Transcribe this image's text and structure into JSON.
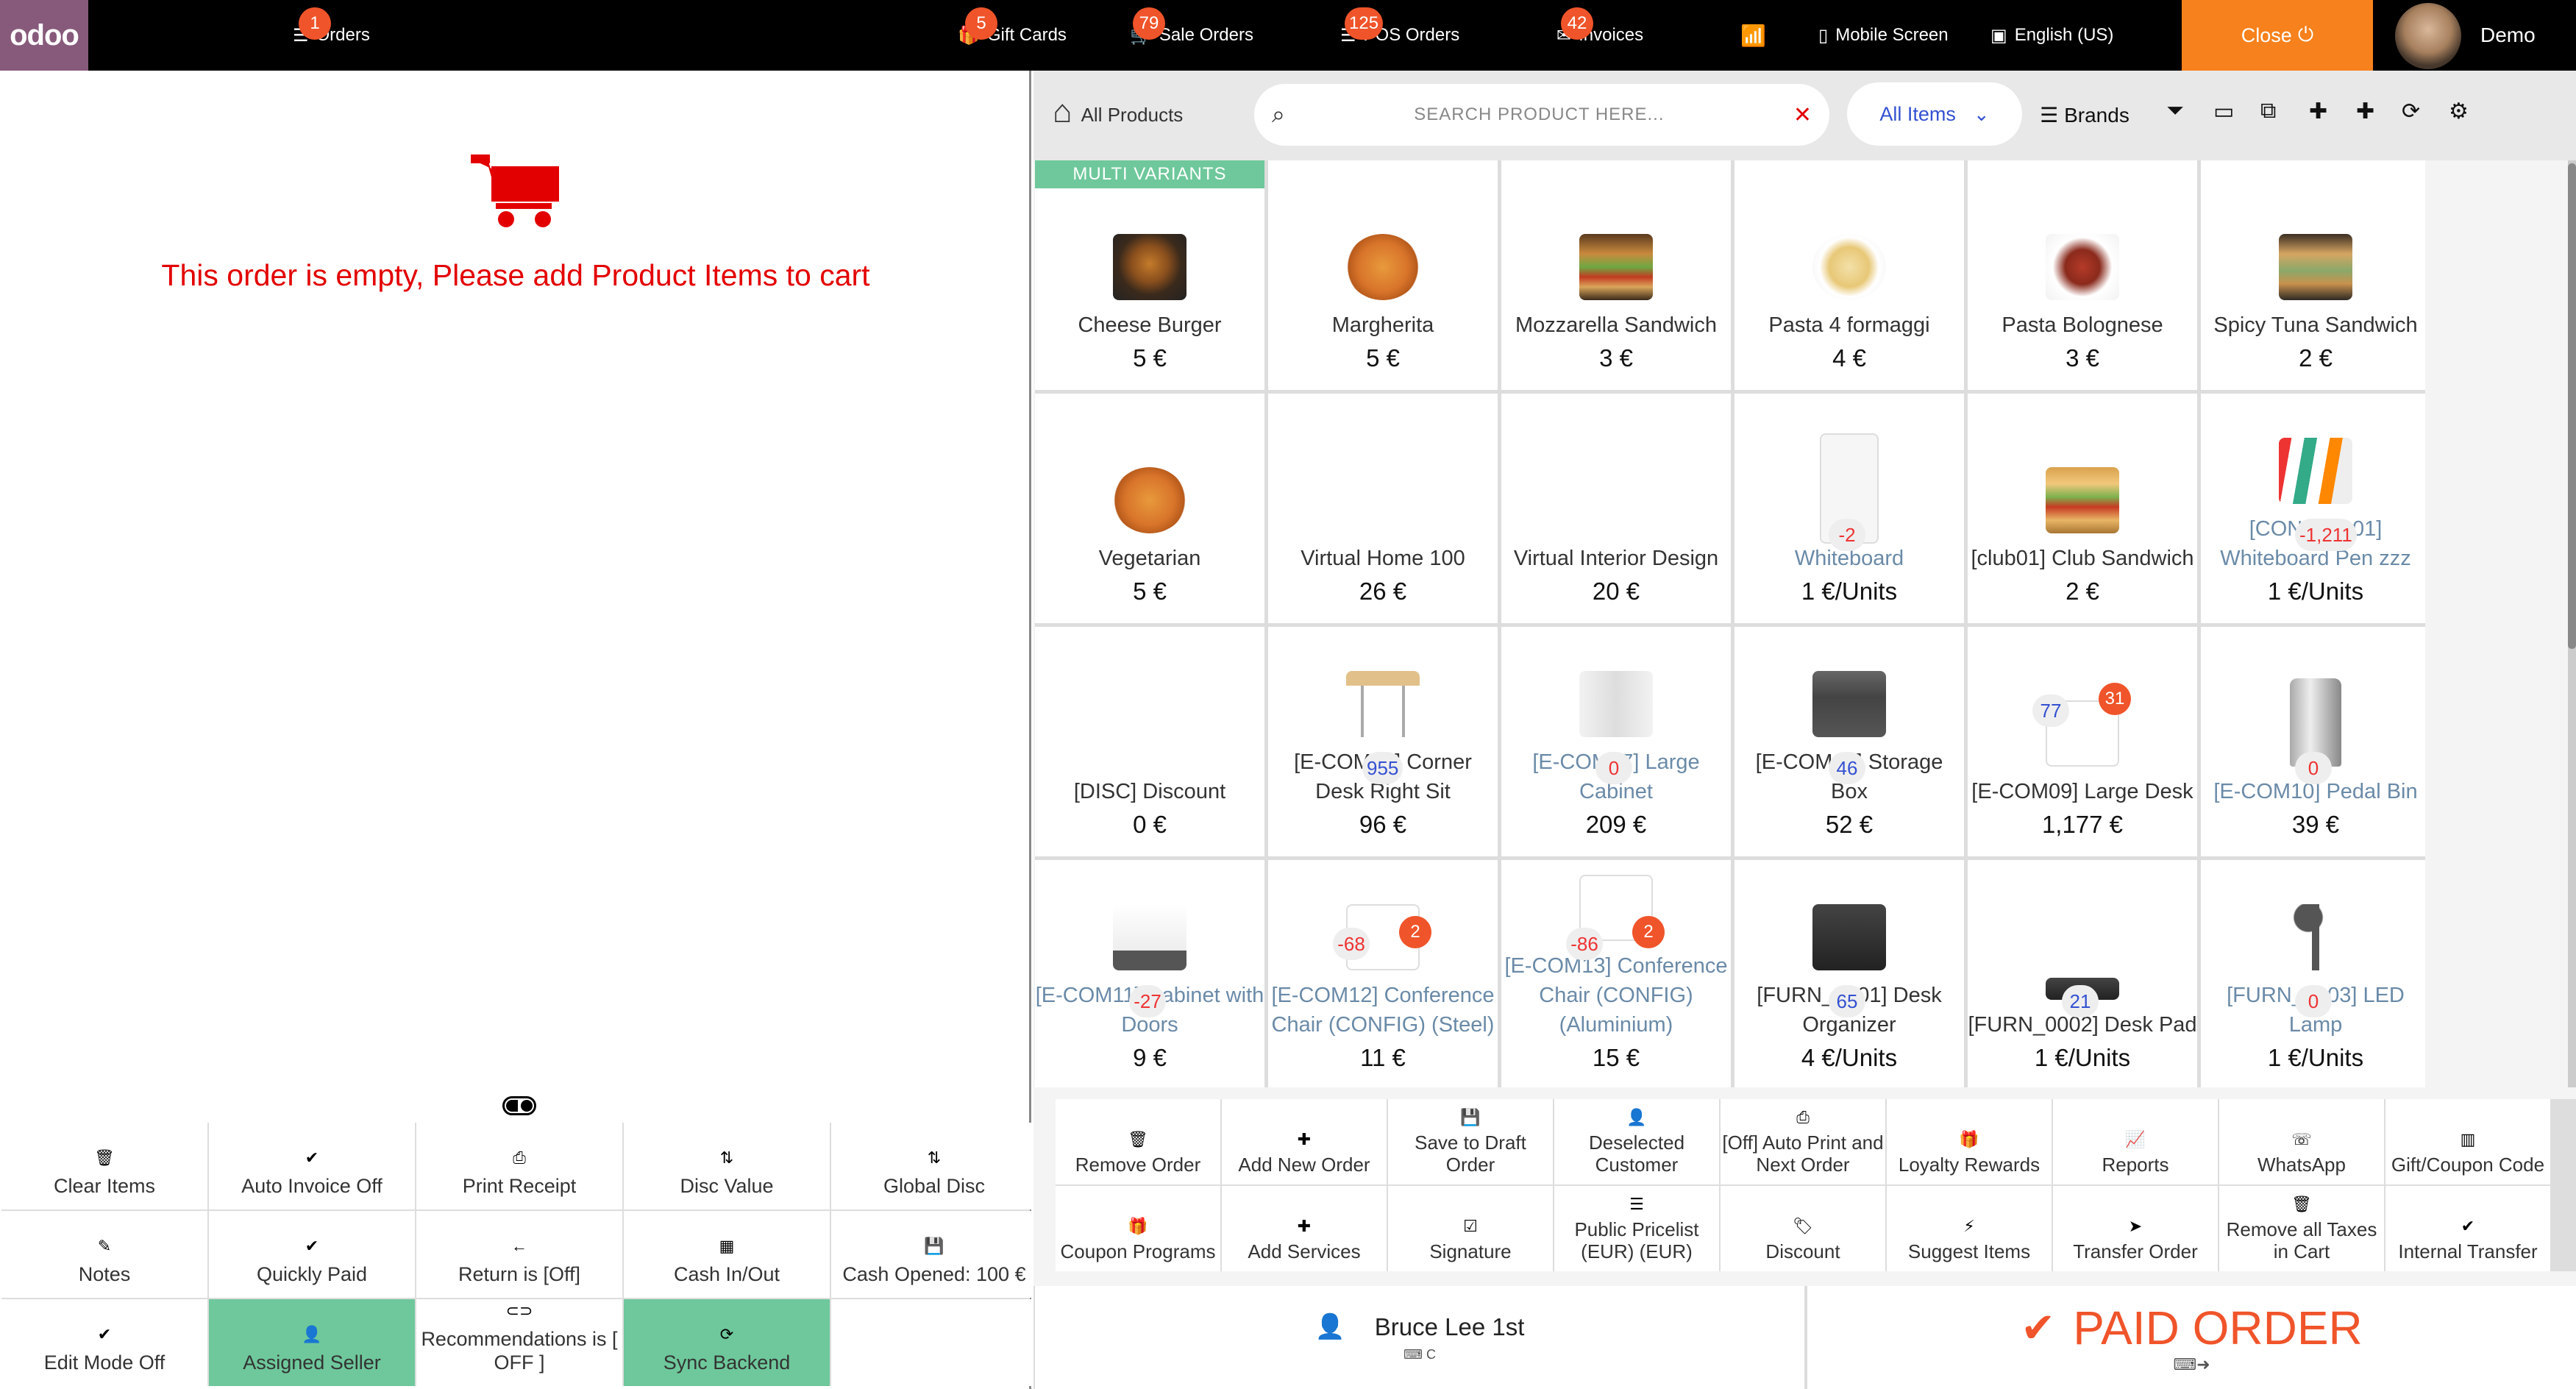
{
  "topbar": {
    "logo": "odoo",
    "orders": {
      "label": "Orders",
      "count": "1"
    },
    "gift_cards": {
      "label": "Gift Cards",
      "count": "5"
    },
    "sale_orders": {
      "label": "Sale Orders",
      "count": "79"
    },
    "pos_orders": {
      "label": "POS Orders",
      "count": "125"
    },
    "invoices": {
      "label": "Invoices",
      "count": "42"
    },
    "mobile_screen": "Mobile Screen",
    "language": "English (US)",
    "close": "Close",
    "user": "Demo"
  },
  "cart": {
    "empty_message": "This order is empty, Please add Product Items to cart"
  },
  "left_buttons": [
    {
      "label": "Clear Items",
      "icon": "trash-icon",
      "glyph": "🗑",
      "style": ""
    },
    {
      "label": "Auto Invoice Off",
      "icon": "check-icon",
      "glyph": "✔",
      "style": ""
    },
    {
      "label": "Print Receipt",
      "icon": "print-icon",
      "glyph": "⎙",
      "style": ""
    },
    {
      "label": "Disc Value",
      "icon": "sort-icon",
      "glyph": "⇅",
      "style": ""
    },
    {
      "label": "Global Disc",
      "icon": "sort-icon",
      "glyph": "⇅",
      "style": ""
    },
    {
      "label": "Notes",
      "icon": "edit-icon",
      "glyph": "✎",
      "style": ""
    },
    {
      "label": "Quickly Paid",
      "icon": "check-icon",
      "glyph": "✔",
      "style": ""
    },
    {
      "label": "Return is [Off]",
      "icon": "arrow-left-icon",
      "glyph": "←",
      "style": ""
    },
    {
      "label": "Cash In/Out",
      "icon": "calculator-icon",
      "glyph": "▦",
      "style": ""
    },
    {
      "label": "Cash Opened: 100 €",
      "icon": "save-icon",
      "glyph": "💾",
      "style": ""
    },
    {
      "label": "Edit Mode Off",
      "icon": "check-icon",
      "glyph": "✔",
      "style": ""
    },
    {
      "label": "Assigned Seller",
      "icon": "user-icon",
      "glyph": "👤",
      "style": "green"
    },
    {
      "label": "Recommendations is [ OFF ]",
      "icon": "toggle-icon",
      "glyph": "⊂⊃",
      "style": ""
    },
    {
      "label": "Sync Backend",
      "icon": "refresh-icon",
      "glyph": "⟳",
      "style": "green"
    },
    {
      "label": "",
      "icon": "",
      "glyph": "",
      "style": "empty"
    }
  ],
  "right_header": {
    "home_label": "All Products",
    "search_placeholder": "SEARCH PRODUCT HERE...",
    "category_filter": "All Items",
    "brands": "Brands"
  },
  "products": [
    {
      "name": "Cheese Burger",
      "price": "5 €",
      "img": "burger",
      "multi": "MULTI VARIANTS"
    },
    {
      "name": "Margherita",
      "price": "5 €",
      "img": "pizza"
    },
    {
      "name": "Mozzarella Sandwich",
      "price": "3 €",
      "img": "sandwich"
    },
    {
      "name": "Pasta 4 formaggi",
      "price": "4 €",
      "img": "pasta"
    },
    {
      "name": "Pasta Bolognese",
      "price": "3 €",
      "img": "bolognese"
    },
    {
      "name": "Spicy Tuna Sandwich",
      "price": "2 €",
      "img": "tuna"
    },
    {
      "name": "Vegetarian",
      "price": "5 €",
      "img": "pizza"
    },
    {
      "name": "Virtual Home 100",
      "price": "26 €",
      "img": ""
    },
    {
      "name": "Virtual Interior Design",
      "price": "20 €",
      "img": ""
    },
    {
      "name": "Whiteboard",
      "price": "1 €/Units",
      "img": "whiteboard",
      "stock": "-2",
      "muted": true
    },
    {
      "name": "[club01] Club Sandwich",
      "price": "2 €",
      "img": "club"
    },
    {
      "name": "[CONS_0001] Whiteboard Pen zzz",
      "price": "1 €/Units",
      "img": "pens",
      "stock": "-1,211",
      "muted": true
    },
    {
      "name": "[DISC] Discount",
      "price": "0 €",
      "img": ""
    },
    {
      "name": "[E-COM06] Corner Desk Right Sit",
      "price": "96 €",
      "img": "desk",
      "stock": "955"
    },
    {
      "name": "[E-COM07] Large Cabinet",
      "price": "209 €",
      "img": "cabinet",
      "stock": "0",
      "muted": true
    },
    {
      "name": "[E-COM08] Storage Box",
      "price": "52 €",
      "img": "box",
      "stock": "46"
    },
    {
      "name": "[E-COM09] Large Desk",
      "price": "1,177 €",
      "img": "group",
      "stock": "77",
      "order_badge": "31"
    },
    {
      "name": "[E-COM10] Pedal Bin",
      "price": "39 €",
      "img": "bin",
      "stock": "0",
      "muted": true
    },
    {
      "name": "[E-COM11] Cabinet with Doors",
      "price": "9 €",
      "img": "cabinet2",
      "stock": "-27",
      "muted": true
    },
    {
      "name": "[E-COM12] Conference Chair (CONFIG) (Steel)",
      "price": "11 €",
      "img": "group",
      "stock": "-68",
      "order_badge": "2",
      "muted": true
    },
    {
      "name": "[E-COM13] Conference Chair (CONFIG) (Aluminium)",
      "price": "15 €",
      "img": "group",
      "stock": "-86",
      "order_badge": "2",
      "muted": true
    },
    {
      "name": "[FURN_0001] Desk Organizer",
      "price": "4 €/Units",
      "img": "organizer",
      "stock": "65"
    },
    {
      "name": "[FURN_0002] Desk Pad",
      "price": "1 €/Units",
      "img": "pad",
      "stock": "21"
    },
    {
      "name": "[FURN_0003] LED Lamp",
      "price": "1 €/Units",
      "img": "lamp",
      "stock": "0",
      "muted": true
    }
  ],
  "action_buttons": [
    {
      "label": "Remove Order",
      "icon": "trash-icon",
      "glyph": "🗑"
    },
    {
      "label": "Add New Order",
      "icon": "plus-icon",
      "glyph": "✚"
    },
    {
      "label": "Save to Draft Order",
      "icon": "save-icon",
      "glyph": "💾"
    },
    {
      "label": "Deselected Customer",
      "icon": "user-times-icon",
      "glyph": "👤"
    },
    {
      "label": "[Off] Auto Print and Next Order",
      "icon": "print-icon",
      "glyph": "⎙"
    },
    {
      "label": "Loyalty Rewards",
      "icon": "gift-icon",
      "glyph": "🎁"
    },
    {
      "label": "Reports",
      "icon": "chart-icon",
      "glyph": "📈"
    },
    {
      "label": "WhatsApp",
      "icon": "whatsapp-icon",
      "glyph": "☏"
    },
    {
      "label": "Gift/Coupon Code",
      "icon": "barcode-icon",
      "glyph": "▥"
    },
    {
      "label": "Coupon Programs",
      "icon": "gift-icon",
      "glyph": "🎁"
    },
    {
      "label": "Add Services",
      "icon": "plus-icon",
      "glyph": "✚"
    },
    {
      "label": "Signature",
      "icon": "check-square-icon",
      "glyph": "☑"
    },
    {
      "label": "Public Pricelist (EUR) (EUR)",
      "icon": "list-icon",
      "glyph": "☰"
    },
    {
      "label": "Discount",
      "icon": "tag-icon",
      "glyph": "🏷"
    },
    {
      "label": "Suggest Items",
      "icon": "bolt-icon",
      "glyph": "⚡"
    },
    {
      "label": "Transfer Order",
      "icon": "send-icon",
      "glyph": "➤"
    },
    {
      "label": "Remove all Taxes in Cart",
      "icon": "trash-icon",
      "glyph": "🗑"
    },
    {
      "label": "Internal Transfer",
      "icon": "check-icon",
      "glyph": "✔"
    }
  ],
  "bottom": {
    "customer_name": "Bruce Lee 1st",
    "customer_shortcut": "C",
    "paid_label": "PAID ORDER"
  },
  "colors": {
    "accent_orange": "#f0542a",
    "close_orange": "#f7811c",
    "odoo_purple": "#875a7b",
    "green": "#6ec89b",
    "error_red": "#e30000",
    "link_blue": "#3451d1"
  }
}
